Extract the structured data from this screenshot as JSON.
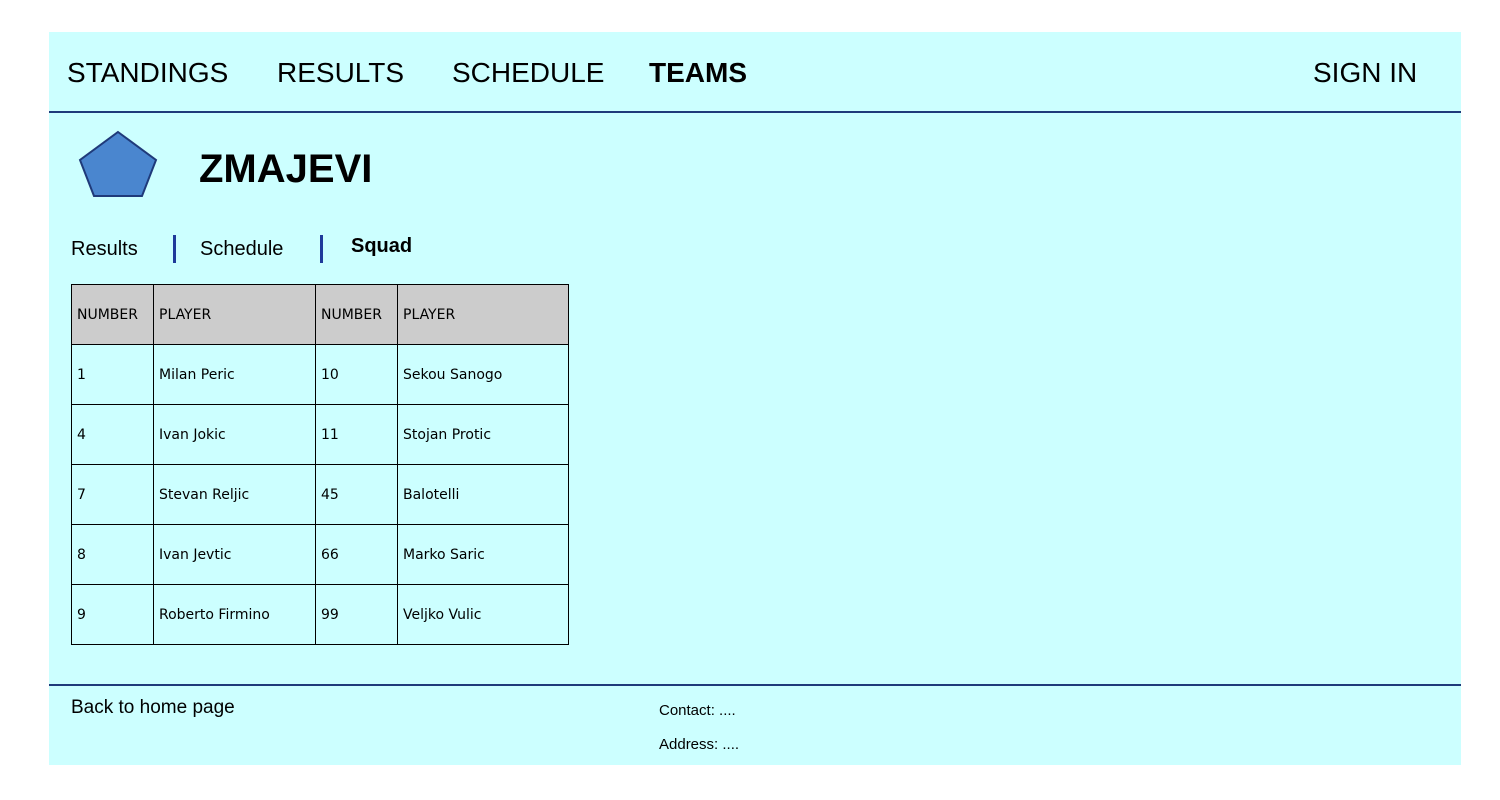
{
  "nav": {
    "standings": "STANDINGS",
    "results": "RESULTS",
    "schedule": "SCHEDULE",
    "teams": "TEAMS",
    "sign_in": "SIGN IN"
  },
  "team": {
    "name": "ZMAJEVI",
    "logo_icon": "pentagon-icon",
    "logo_color": "#4a86cf"
  },
  "subnav": {
    "results": "Results",
    "schedule": "Schedule",
    "squad": "Squad"
  },
  "squad_table": {
    "headers": [
      "NUMBER",
      "PLAYER",
      "NUMBER",
      "PLAYER"
    ],
    "rows": [
      [
        "1",
        "Milan Peric",
        "10",
        "Sekou Sanogo"
      ],
      [
        "4",
        "Ivan Jokic",
        "11",
        "Stojan Protic"
      ],
      [
        "7",
        "Stevan Reljic",
        "45",
        "Balotelli"
      ],
      [
        "8",
        "Ivan Jevtic",
        "66",
        "Marko Saric"
      ],
      [
        "9",
        "Roberto Firmino",
        "99",
        "Veljko Vulic"
      ]
    ]
  },
  "footer": {
    "back_link": "Back to home page",
    "contact": "Contact: ....",
    "address": "Address: ...."
  },
  "colors": {
    "background": "#ccffff",
    "accent": "#1f3a7a",
    "table_header": "#cccccc"
  }
}
